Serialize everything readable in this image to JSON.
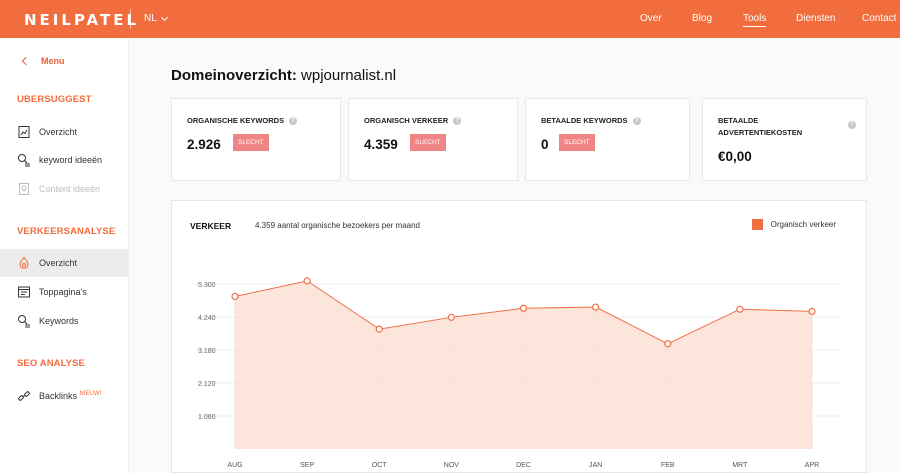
{
  "header": {
    "logo": "NEILPATEL",
    "language": "NL",
    "nav": [
      "Over",
      "Blog",
      "Tools",
      "Diensten",
      "Contact"
    ],
    "active_nav": "Tools",
    "accent": "#f26d3d"
  },
  "sidebar": {
    "menu_label": "Menu",
    "sections": [
      {
        "title": "UBERSUGGEST",
        "items": [
          {
            "label": "Overzicht",
            "icon": "overview-icon"
          },
          {
            "label": "keyword ideeën",
            "icon": "keyword-ideas-icon"
          },
          {
            "label": "Content ideeën",
            "icon": "content-ideas-icon",
            "disabled": true
          }
        ]
      },
      {
        "title": "VERKEERSANALYSE",
        "items": [
          {
            "label": "Overzicht",
            "icon": "traffic-overview-icon",
            "active": true
          },
          {
            "label": "Toppagina's",
            "icon": "top-pages-icon"
          },
          {
            "label": "Keywords",
            "icon": "keywords-icon"
          }
        ]
      },
      {
        "title": "SEO ANALYSE",
        "items": [
          {
            "label": "Backlinks",
            "icon": "backlinks-icon",
            "badge": "NIEUW!"
          }
        ]
      }
    ]
  },
  "main": {
    "title_prefix": "Domeinoverzicht:",
    "domain": "wpjournalist.nl",
    "cards": [
      {
        "label": "ORGANISCHE KEYWORDS",
        "value": "2.926",
        "badge": "SLECHT"
      },
      {
        "label": "ORGANISCH VERKEER",
        "value": "4.359",
        "badge": "SLECHT"
      },
      {
        "label": "BETAALDE KEYWORDS",
        "value": "0",
        "badge": "SLECHT"
      },
      {
        "label": "BETAALDE ADVERTENTIEKOSTEN",
        "value": "€0,00"
      }
    ],
    "chart_title": "VERKEER",
    "chart_subtitle": "4.359 aantal organische bezoekers per maand"
  },
  "chart_data": {
    "type": "area",
    "categories": [
      "AUG",
      "SEP",
      "OCT",
      "NOV",
      "DEC",
      "JAN",
      "FEB",
      "MRT",
      "APR"
    ],
    "series": [
      {
        "name": "Organisch verkeer",
        "values": [
          4900,
          5400,
          3850,
          4230,
          4520,
          4560,
          3380,
          4490,
          4420
        ],
        "color": "#ef6f45"
      }
    ],
    "y_ticks": [
      "5.300",
      "4.240",
      "3.180",
      "2.120",
      "1.060"
    ],
    "y_tick_values": [
      5300,
      4240,
      3180,
      2120,
      1060
    ],
    "ylim": [
      0,
      6360
    ],
    "legend": "top-right",
    "grid": true
  }
}
